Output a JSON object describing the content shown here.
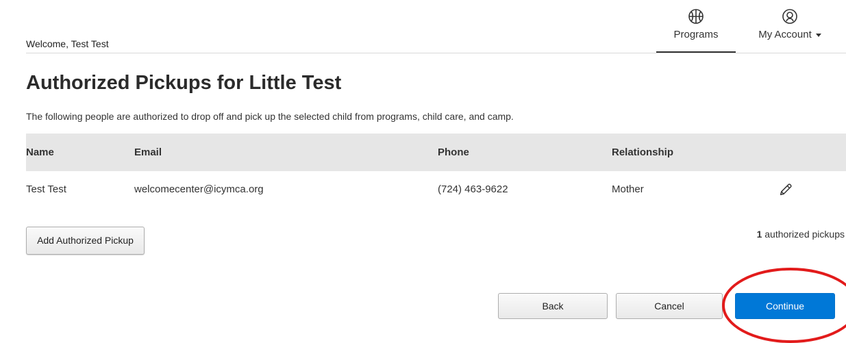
{
  "header": {
    "welcome_text": "Welcome, Test Test",
    "nav": [
      {
        "label": "Programs",
        "icon": "basketball-icon",
        "active": true
      },
      {
        "label": "My Account",
        "icon": "user-circle-icon",
        "has_dropdown": true
      }
    ]
  },
  "main": {
    "title": "Authorized Pickups for Little Test",
    "description": "The following people are authorized to drop off and pick up the selected child from programs, child care, and camp.",
    "table": {
      "headers": [
        "Name",
        "Email",
        "Phone",
        "Relationship"
      ],
      "rows": [
        {
          "name": "Test Test",
          "email": "welcomecenter@icymca.org",
          "phone": "(724) 463-9622",
          "relationship": "Mother",
          "edit_icon": "pencil-icon"
        }
      ]
    },
    "add_button_label": "Add Authorized Pickup",
    "pickup_count": "1",
    "pickup_count_suffix": " authorized pickups"
  },
  "footer_buttons": {
    "back_label": "Back",
    "cancel_label": "Cancel",
    "continue_label": "Continue"
  },
  "colors": {
    "primary_button": "#0078d7",
    "highlight_ring": "#e21b1b",
    "table_header_bg": "#e6e6e6"
  }
}
